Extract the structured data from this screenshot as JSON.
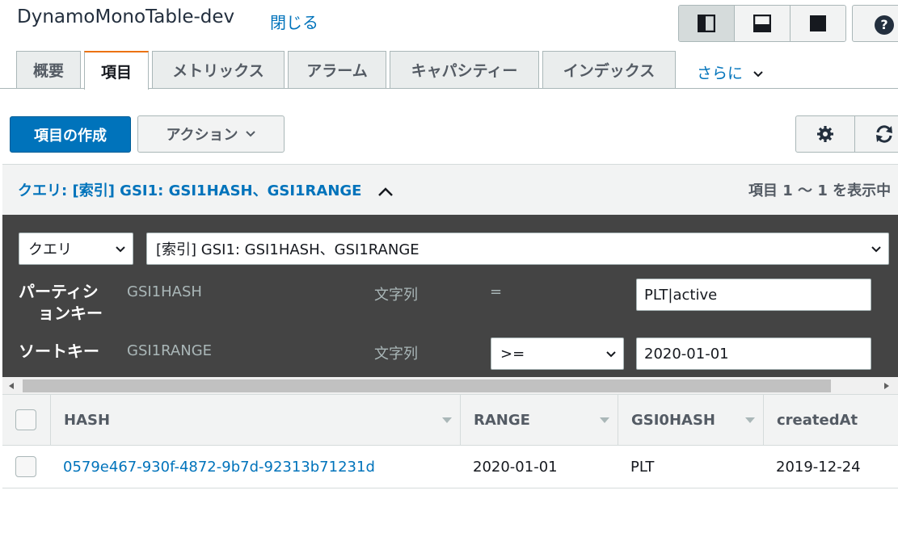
{
  "header": {
    "table_name": "DynamoMonoTable-dev",
    "close_link": "閉じる",
    "help_label": "?"
  },
  "tabs": [
    {
      "label": "概要"
    },
    {
      "label": "項目",
      "active": true
    },
    {
      "label": "メトリックス"
    },
    {
      "label": "アラーム"
    },
    {
      "label": "キャパシティー"
    },
    {
      "label": "インデックス"
    }
  ],
  "tabs_more": "さらに",
  "toolbar": {
    "create_item": "項目の作成",
    "actions": "アクション"
  },
  "query": {
    "title": "クエリ: [索引] GSI1: GSI1HASH、GSI1RANGE",
    "count_text": "項目 1 ～ 1 を表示中",
    "mode_select": "クエリ",
    "index_select": "[索引] GSI1: GSI1HASH、GSI1RANGE",
    "partition": {
      "label_line1": "パーティシ",
      "label_line2": "ョンキー",
      "name": "GSI1HASH",
      "type": "文字列",
      "operator": "=",
      "value": "PLT|active"
    },
    "sort": {
      "label": "ソートキー",
      "name": "GSI1RANGE",
      "type": "文字列",
      "operator": ">=",
      "value": "2020-01-01"
    }
  },
  "table": {
    "columns": [
      "HASH",
      "RANGE",
      "GSI0HASH",
      "createdAt"
    ],
    "rows": [
      {
        "HASH": "0579e467-930f-4872-9b7d-92313b71231d",
        "RANGE": "2020-01-01",
        "GSI0HASH": "PLT",
        "createdAt": "2019-12-24"
      }
    ]
  },
  "colors": {
    "link": "#0073bb",
    "primary": "#0073bb",
    "active_tab_accent": "#ec7211",
    "panel_bg": "#444444"
  },
  "icons": [
    "layout-split-vertical-icon",
    "layout-split-horizontal-icon",
    "layout-full-icon",
    "help-icon",
    "settings-gear-icon",
    "refresh-icon",
    "chevron-down-icon",
    "chevron-up-icon"
  ]
}
